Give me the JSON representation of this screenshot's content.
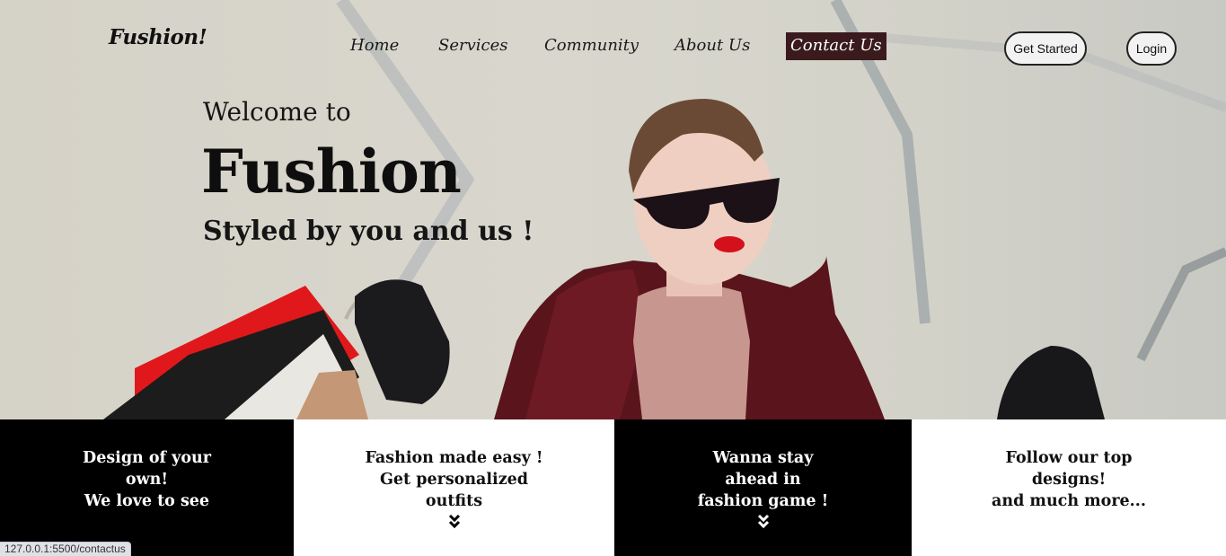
{
  "brand": {
    "name": "Fushion!"
  },
  "nav": {
    "links": [
      "Home",
      "Services",
      "Community",
      "About Us",
      "Contact Us"
    ],
    "active": "Contact Us"
  },
  "buttons": {
    "get_started": "Get Started",
    "login": "Login"
  },
  "hero": {
    "welcome": "Welcome to",
    "title": "Fushion",
    "tagline": "Styled by you and us !"
  },
  "tiles": [
    {
      "text": "Design of your\nown!\nWe love to see",
      "theme": "dark",
      "has_chevron": false
    },
    {
      "text": "Fashion made easy !\nGet personalized\noutfits",
      "theme": "light",
      "has_chevron": true
    },
    {
      "text": "Wanna stay\nahead in\nfashion game !",
      "theme": "dark",
      "has_chevron": true
    },
    {
      "text": "Follow our top\ndesigns!\nand much more...",
      "theme": "light",
      "has_chevron": false
    }
  ],
  "status_bar": {
    "url": "127.0.0.1:5500/contactus"
  },
  "colors": {
    "active_nav_bg": "#3a1a1c",
    "tile_dark": "#000000",
    "tile_light": "#ffffff",
    "hero_bg": "#d7d5cb"
  },
  "icons": {
    "tile_chevron": "double-chevron-down-icon"
  }
}
